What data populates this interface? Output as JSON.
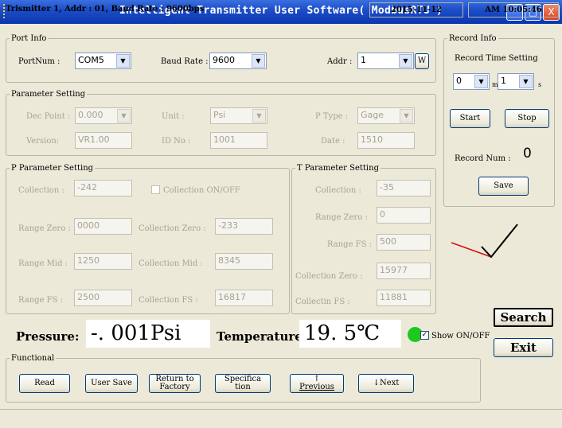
{
  "window": {
    "title": "Intelligent Transmitter User Software( ModbusRTU )",
    "min": "_",
    "max": "□",
    "close": "X"
  },
  "port": {
    "legend": "Port Info",
    "portnum_label": "PortNum :",
    "portnum_value": "COM5",
    "baud_label": "Baud Rate :",
    "baud_value": "9600",
    "addr_label": "Addr :",
    "addr_value": "1",
    "w_button": "W"
  },
  "record": {
    "legend": "Record Info",
    "time_label": "Record Time Setting",
    "min_value": "0",
    "min_unit": "m",
    "sec_value": "1",
    "sec_unit": "s",
    "start": "Start",
    "stop": "Stop",
    "num_label": "Record Num :",
    "num_value": "0",
    "save": "Save"
  },
  "param": {
    "legend": "Parameter Setting",
    "dec_label": "Dec Point :",
    "dec_value": "0.000",
    "unit_label": "Unit  :",
    "unit_value": "Psi",
    "ptype_label": "P Type :",
    "ptype_value": "Gage",
    "version_label": "Version:",
    "version_value": "VR1.00",
    "idno_label": "ID No  :",
    "idno_value": "1001",
    "date_label": "Date :",
    "date_value": "1510"
  },
  "pparam": {
    "legend": "P Parameter Setting",
    "collection_label": "Collection :",
    "collection_value": "-242",
    "collection_onoff": "Collection ON/OFF",
    "range_zero_label": "Range Zero :",
    "range_zero_value": "0000",
    "coll_zero_label": "Collection Zero :",
    "coll_zero_value": "-233",
    "range_mid_label": "Range Mid :",
    "range_mid_value": "1250",
    "coll_mid_label": "Collection Mid :",
    "coll_mid_value": "8345",
    "range_fs_label": "Range FS :",
    "range_fs_value": "2500",
    "coll_fs_label": "Collection FS  :",
    "coll_fs_value": "16817"
  },
  "tparam": {
    "legend": "T Parameter Setting",
    "collection_label": "Collection :",
    "collection_value": "-35",
    "range_zero_label": "Range Zero :",
    "range_zero_value": "0",
    "range_fs_label": "Range FS :",
    "range_fs_value": "500",
    "coll_zero_label": "Collection Zero :",
    "coll_zero_value": "15977",
    "coll_fs_label": "Collectin FS   :",
    "coll_fs_value": "11881"
  },
  "readout": {
    "pressure_label": "Pressure:",
    "pressure_value": "-. 001Psi",
    "temperature_label": "Temperature:",
    "temperature_value": "19. 5℃",
    "show_label": "Show ON/OFF",
    "status_color": "#1ec81e"
  },
  "buttons": {
    "search": "Search",
    "exit": "Exit"
  },
  "functional": {
    "legend": "Functional",
    "read": "Read",
    "user_save": "User Save",
    "return_l1": "Return to",
    "return_l2": "Factory",
    "spec_l1": "Specifica",
    "spec_l2": "tion",
    "prev_arrow": "↑",
    "prev_label": "Previous",
    "next_label": "↓Next"
  },
  "status": {
    "left": "Trismitter 1, Addr : 01, Baud Rate : 9600bps",
    "date": "2015-11-12",
    "time": "AM 10:05:46"
  }
}
